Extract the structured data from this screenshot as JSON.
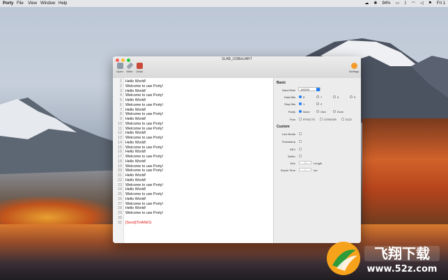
{
  "menubar": {
    "app": "Porty",
    "items": [
      "File",
      "View",
      "Window",
      "Help"
    ],
    "battery": "94%",
    "time": "Fri 1"
  },
  "window": {
    "title": "SLAB_USBtoUART",
    "toolbar": {
      "open": "Open",
      "write": "Write",
      "clean": "Clean",
      "settings": "Settings"
    }
  },
  "editor": {
    "line_numbers": [
      "1",
      "2",
      "3",
      "4",
      "5",
      "6",
      "7",
      "8",
      "9",
      "10",
      "11",
      "12",
      "13",
      "14",
      "15",
      "16",
      "17",
      "18",
      "19",
      "20",
      "21",
      "22",
      "23",
      "24",
      "25",
      "26",
      "27",
      "28",
      "29",
      "30",
      "31"
    ],
    "lines": [
      "Hello World!",
      "Welcome to use Porty!",
      "Hello World!",
      "Welcome to use Porty!",
      "Hello World!",
      "Welcome to use Porty!",
      "Hello World!",
      "Welcome to use Porty!",
      "Hello World!",
      "Welcome to use Porty!",
      "Welcome to use Porty!",
      "Hello World!",
      "Welcome to use Porty!",
      "Hello World!",
      "Welcome to use Porty!",
      "Hello World!",
      "Welcome to use Porty!",
      "Hello World!",
      "Welcome to use Porty!",
      "Welcome to use Porty!",
      "Hello World!",
      "Hello World!",
      "Welcome to use Porty!",
      "Hello World!",
      "Welcome to use Porty!",
      "Hello World!",
      "Welcome to use Porty!",
      "Hello World!",
      "Welcome to use Porty!",
      "",
      "[Send]THANKS"
    ]
  },
  "settings": {
    "basic_title": "Basic",
    "baud_rate_label": "Baud Rate",
    "baud_rate_value": "115200",
    "data_bits_label": "Data Bits",
    "data_bits_options": [
      "8",
      "7",
      "6",
      "5"
    ],
    "stop_bits_label": "Stop Bits",
    "stop_bits_options": [
      "1",
      "2"
    ],
    "parity_label": "Parity",
    "parity_options": [
      "None",
      "Odd",
      "Even"
    ],
    "flow_label": "Flow",
    "flow_options": [
      "RTS/CTS",
      "DTR/DSR",
      "DCD"
    ],
    "custom_title": "Custom",
    "line_break_label": "Line Break",
    "timestamp_label": "Timestamp",
    "hex_label": "HEX",
    "buffer_label": "Buffer",
    "size_label": "Size",
    "size_placeholder": "10",
    "size_unit": "Length",
    "expire_label": "Expire Time",
    "expire_placeholder": "1",
    "expire_unit": "ms"
  },
  "colors": {
    "accent": "#1e7cf2",
    "send_text": "#e0201f",
    "close": "#fc5f57",
    "minimize": "#fdbc2e",
    "zoom": "#28c840"
  }
}
